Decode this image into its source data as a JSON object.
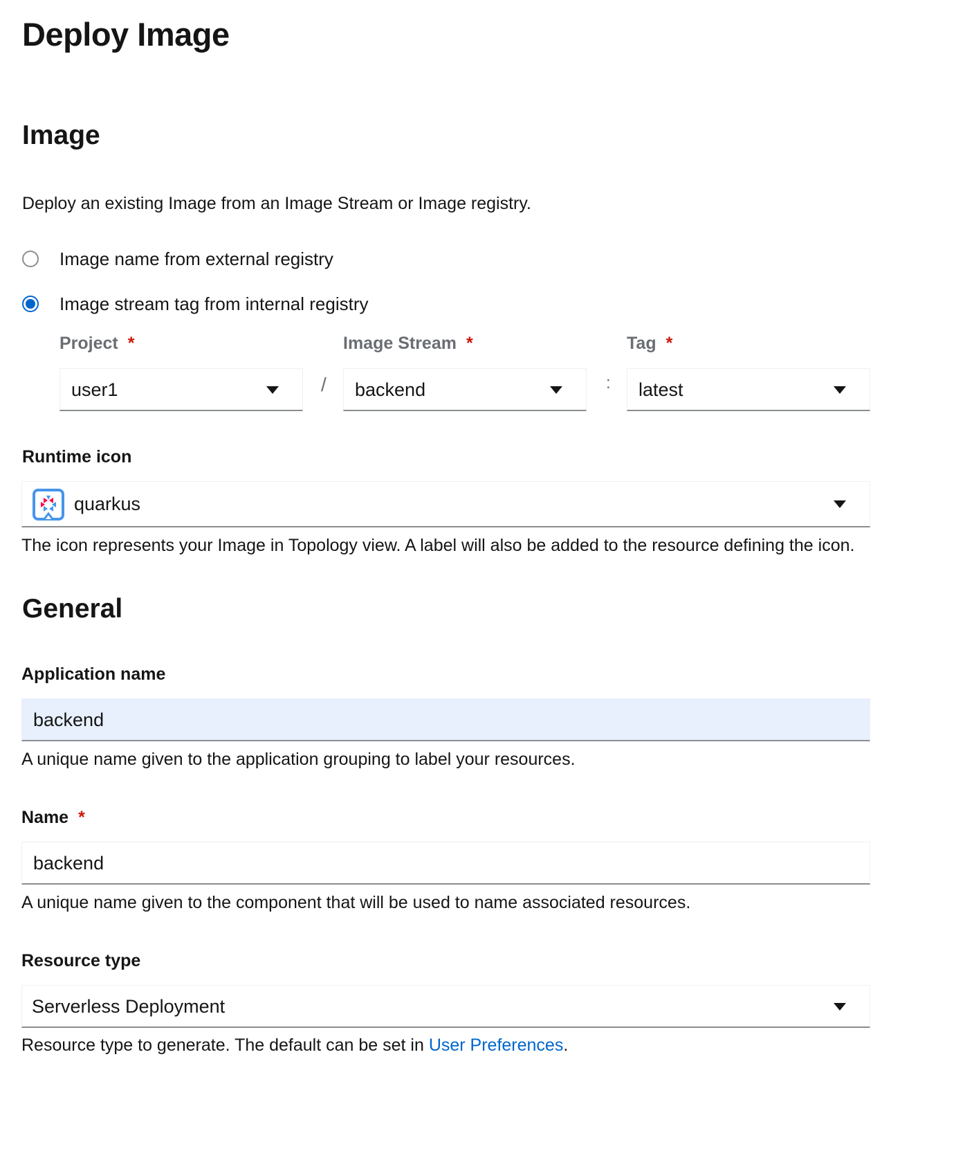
{
  "page": {
    "title": "Deploy Image"
  },
  "image_section": {
    "heading": "Image",
    "description": "Deploy an existing Image from an Image Stream or Image registry.",
    "radio_options": [
      {
        "label": "Image name from external registry",
        "checked": false
      },
      {
        "label": "Image stream tag from internal registry",
        "checked": true
      }
    ],
    "project": {
      "label": "Project",
      "value": "user1"
    },
    "image_stream": {
      "label": "Image Stream",
      "value": "backend"
    },
    "tag": {
      "label": "Tag",
      "value": "latest"
    },
    "separator_slash": "/",
    "separator_colon": ":",
    "runtime_icon": {
      "label": "Runtime icon",
      "value": "quarkus",
      "icon": "quarkus-logo-icon",
      "help": "The icon represents your Image in Topology view. A label will also be added to the resource defining the icon."
    }
  },
  "general_section": {
    "heading": "General",
    "application_name": {
      "label": "Application name",
      "value": "backend",
      "help": "A unique name given to the application grouping to label your resources."
    },
    "name": {
      "label": "Name",
      "value": "backend",
      "help": "A unique name given to the component that will be used to name associated resources."
    },
    "resource_type": {
      "label": "Resource type",
      "value": "Serverless Deployment",
      "help_prefix": "Resource type to generate. The default can be set in ",
      "help_link": "User Preferences",
      "help_suffix": "."
    }
  },
  "required_marker": "*",
  "colors": {
    "accent": "#0066cc",
    "required": "#c9190b",
    "autofill_bg": "#e8f0fe",
    "muted_label": "#6a6e73"
  }
}
